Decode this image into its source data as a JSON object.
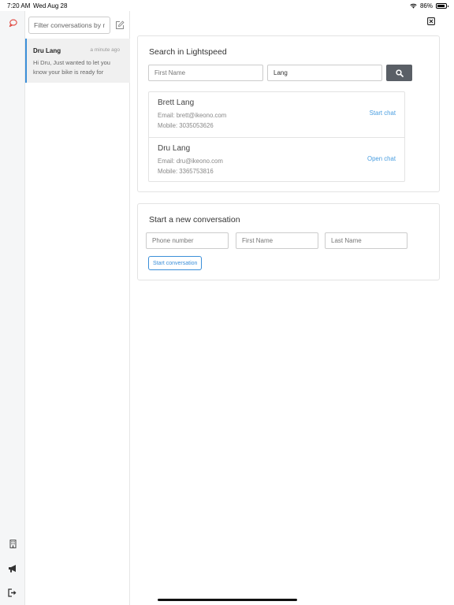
{
  "status_bar": {
    "time": "7:20 AM",
    "date": "Wed Aug 28",
    "battery": "86%"
  },
  "rail": {
    "icons": [
      "chat-icon",
      "building-icon",
      "megaphone-icon",
      "logout-icon"
    ]
  },
  "conversations": {
    "filter_placeholder": "Filter conversations by name",
    "items": [
      {
        "name": "Dru Lang",
        "time": "a minute ago",
        "preview": "Hi Dru, Just wanted to let you know your bike is ready for"
      }
    ]
  },
  "search_card": {
    "title": "Search in Lightspeed",
    "first_name_placeholder": "First Name",
    "last_name_value": "Lang",
    "results": [
      {
        "name": "Brett Lang",
        "email": "Email: brett@ikeono.com",
        "mobile": "Mobile: 3035053626",
        "action": "Start chat"
      },
      {
        "name": "Dru Lang",
        "email": "Email: dru@ikeono.com",
        "mobile": "Mobile: 3365753816",
        "action": "Open chat"
      }
    ]
  },
  "new_conversation": {
    "title": "Start a new conversation",
    "phone_placeholder": "Phone number",
    "first_name_placeholder": "First Name",
    "last_name_placeholder": "Last Name",
    "button_label": "Start conversation"
  },
  "colors": {
    "accent": "#3b8fd9",
    "search_button": "#5a5f66",
    "active_item_bg": "#f0f0f0"
  }
}
